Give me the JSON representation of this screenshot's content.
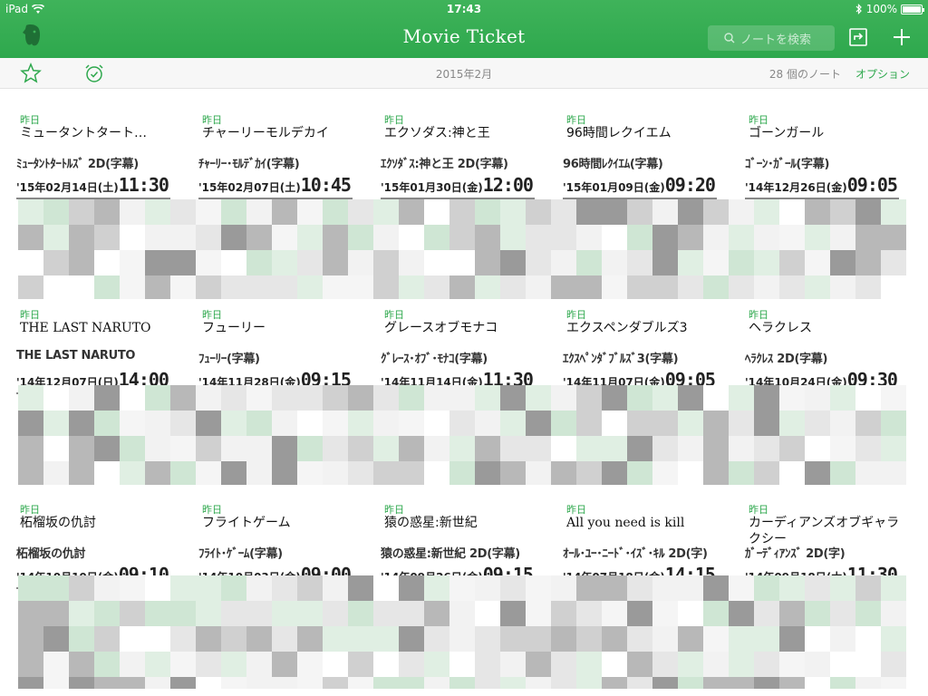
{
  "status_bar": {
    "device": "iPad",
    "time": "17:43",
    "battery": "100%"
  },
  "nav": {
    "title": "Movie Ticket",
    "search_placeholder": "ノートを検索"
  },
  "toolbar": {
    "date_heading": "2015年2月",
    "note_count": "28 個のノート",
    "options": "オプション"
  },
  "colors": {
    "accent": "#2ea84d",
    "bar": "#37ad53"
  },
  "notes": [
    {
      "date": "昨日",
      "title": "ミュータントタート…",
      "line1": "ﾐｭｰﾀﾝﾄﾀｰﾄﾙｽﾞ 2D(字幕)",
      "day": "'15年02月14日(土)",
      "time": "11:30"
    },
    {
      "date": "昨日",
      "title": "チャーリーモルデカイ",
      "line1": "ﾁｬｰﾘｰ･ﾓﾙﾃﾞｶｲ(字幕)",
      "day": "'15年02月07日(土)",
      "time": "10:45"
    },
    {
      "date": "昨日",
      "title": "エクソダス:神と王",
      "line1": "ｴｸｿﾀﾞｽ:神と王 2D(字幕)",
      "day": "'15年01月30日(金)",
      "time": "12:00"
    },
    {
      "date": "昨日",
      "title": "96時間レクイエム",
      "line1": "96時間ﾚｸｲｴﾑ(字幕)",
      "day": "'15年01月09日(金)",
      "time": "09:20"
    },
    {
      "date": "昨日",
      "title": "ゴーンガール",
      "line1": "ｺﾞｰﾝ･ｶﾞｰﾙ(字幕)",
      "day": "'14年12月26日(金)",
      "time": "09:05"
    },
    {
      "date": "昨日",
      "title": "THE LAST NARUTO",
      "line1": "THE LAST NARUTO",
      "day": "'14年12月07日(日)",
      "time": "14:00"
    },
    {
      "date": "昨日",
      "title": "フューリー",
      "line1": "ﾌｭｰﾘｰ(字幕)",
      "day": "'14年11月28日(金)",
      "time": "09:15"
    },
    {
      "date": "昨日",
      "title": "グレースオブモナコ",
      "line1": "ｸﾞﾚｰｽ･ｵﾌﾞ･ﾓﾅｺ(字幕)",
      "day": "'14年11月14日(金)",
      "time": "11:30"
    },
    {
      "date": "昨日",
      "title": "エクスペンダブルズ3",
      "line1": "ｴｸｽﾍﾟﾝﾀﾞﾌﾞﾙｽﾞ3(字幕)",
      "day": "'14年11月07日(金)",
      "time": "09:05"
    },
    {
      "date": "昨日",
      "title": "ヘラクレス",
      "line1": "ﾍﾗｸﾚｽ 2D(字幕)",
      "day": "'14年10月24日(金)",
      "time": "09:30"
    },
    {
      "date": "昨日",
      "title": "柘榴坂の仇討",
      "line1": "柘榴坂の仇討",
      "day": "'14年10月10日(金)",
      "time": "09:10"
    },
    {
      "date": "昨日",
      "title": "フライトゲーム",
      "line1": "ﾌﾗｲﾄ･ｹﾞｰﾑ(字幕)",
      "day": "'14年10月03日(金)",
      "time": "09:00"
    },
    {
      "date": "昨日",
      "title": "猿の惑星:新世紀",
      "line1": "猿の惑星:新世紀 2D(字幕)",
      "day": "'14年09月26日(金)",
      "time": "09:15"
    },
    {
      "date": "昨日",
      "title": "All you need is kill",
      "line1": "ｵｰﾙ･ﾕｰ･ﾆｰﾄﾞ･ｲｽﾞ･ｷﾙ 2D(字)",
      "day": "'14年07月18日(金)",
      "time": "14:15"
    },
    {
      "date": "昨日",
      "title": "カーディアンズオブギャラクシー",
      "line1": "ｶﾞｰﾃﾞｨｱﾝｽﾞ 2D(字)",
      "day": "'14年09月18日(木)",
      "time": "11:30"
    }
  ]
}
